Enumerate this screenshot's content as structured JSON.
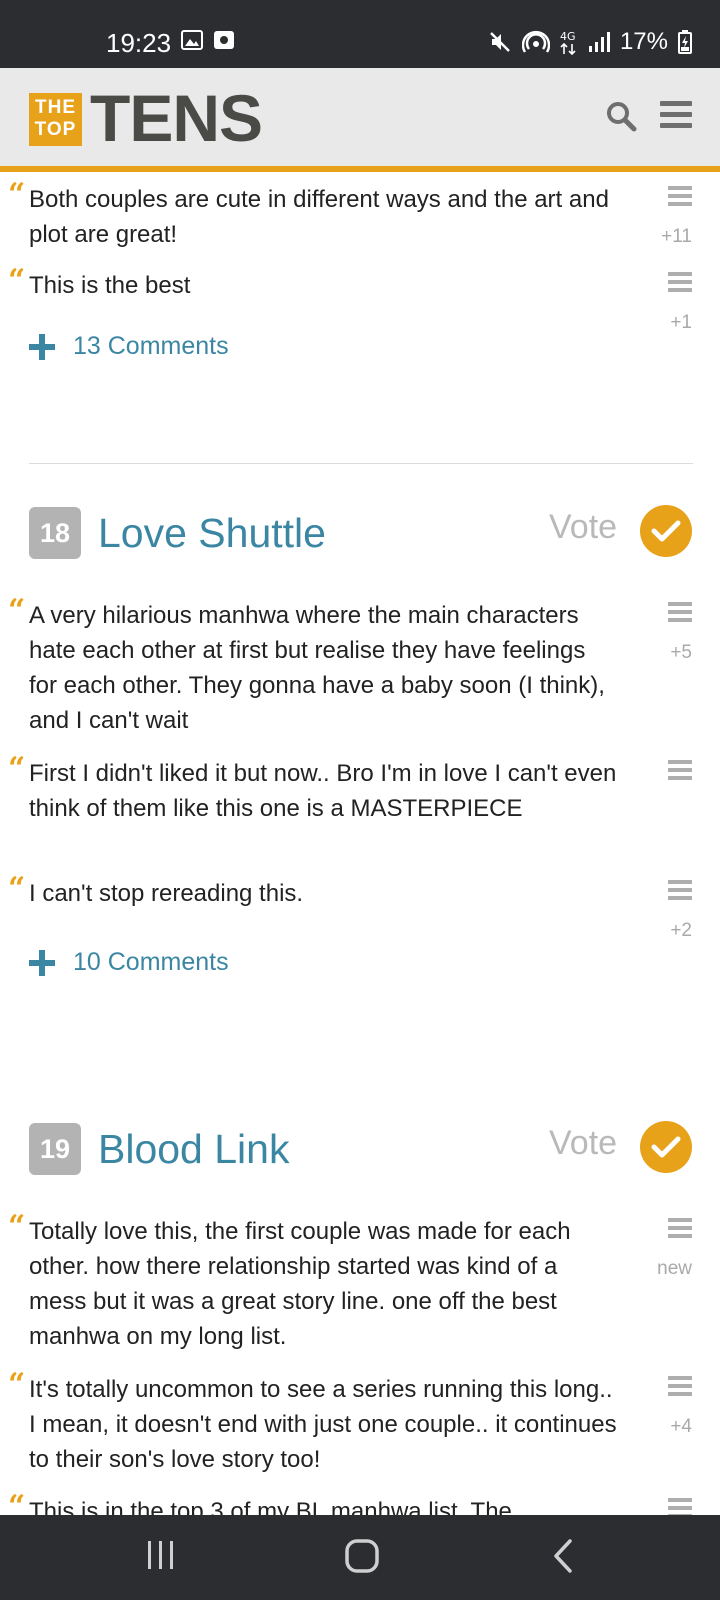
{
  "status_bar": {
    "time": "19:23",
    "battery": "17%",
    "icons": [
      "image-icon",
      "camera-icon",
      "mute-icon",
      "hotspot-icon",
      "network-4g-icon",
      "signal-icon",
      "battery-charging-icon"
    ]
  },
  "header": {
    "logo_top": "THE",
    "logo_bottom": "TOP",
    "logo_text": "TENS",
    "accent_color": "#e8a21a"
  },
  "section_17": {
    "comments": [
      {
        "text": "Both couples are cute in different ways and the art and plot are great!",
        "score": "+11"
      },
      {
        "text": "This is the best",
        "score": "+1"
      }
    ],
    "more_label": "13 Comments"
  },
  "item_18": {
    "rank": "18",
    "title": "Love Shuttle",
    "vote_label": "Vote",
    "comments": [
      {
        "text": "A very hilarious manhwa where the main characters hate each other at first but realise they have feelings for each other. They gonna have a baby soon (I think), and I can't wait",
        "score": "+5"
      },
      {
        "text": "First I didn't liked it but now.. Bro I'm in love I can't even think of them like this one is a MASTERPIECE",
        "score": ""
      },
      {
        "text": "I can't stop rereading this.",
        "score": "+2"
      }
    ],
    "more_label": "10 Comments"
  },
  "item_19": {
    "rank": "19",
    "title": "Blood Link",
    "vote_label": "Vote",
    "comments": [
      {
        "text": "Totally love this, the first couple was made for each other. how there relationship started was kind of a mess but it was a great story line. one off the best manhwa on my long list.",
        "score": "new"
      },
      {
        "text": "It's totally uncommon to see a series running this long.. I mean, it doesn't end with just one couple.. it continues to their son's love story too!",
        "score": "+4"
      },
      {
        "text": "This is in the top 3 of my BL manhwa list. The",
        "score": ""
      }
    ]
  },
  "colors": {
    "link": "#3a86a3",
    "rank_badge": "#b3b3b3",
    "vote_button": "#e8a21a"
  }
}
